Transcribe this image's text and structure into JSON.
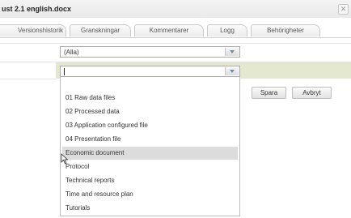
{
  "window": {
    "title": "ust 2.1 english.docx",
    "close_icon": "close-icon"
  },
  "tabs": [
    {
      "label": "Versionshistorik"
    },
    {
      "label": "Granskningar"
    },
    {
      "label": "Kommentarer"
    },
    {
      "label": "Logg"
    },
    {
      "label": "Behörigheter"
    }
  ],
  "filter_select": {
    "value": "(Alla)"
  },
  "category_select": {
    "value": ""
  },
  "buttons": {
    "save": "Spara",
    "cancel": "Avbryt"
  },
  "dropdown": {
    "options": [
      {
        "label": ""
      },
      {
        "label": "01 Raw data files"
      },
      {
        "label": "02 Processed data"
      },
      {
        "label": "03 Application configured file"
      },
      {
        "label": "04 Presentation file"
      },
      {
        "label": "Economic document"
      },
      {
        "label": "Protocol"
      },
      {
        "label": "Technical reports"
      },
      {
        "label": "Time and resource plan"
      },
      {
        "label": "Tutorials"
      }
    ],
    "highlighted": "Economic document"
  },
  "colors": {
    "form_row_bg": "#e4e8cf",
    "highlight_bg": "#dcdcdc"
  }
}
